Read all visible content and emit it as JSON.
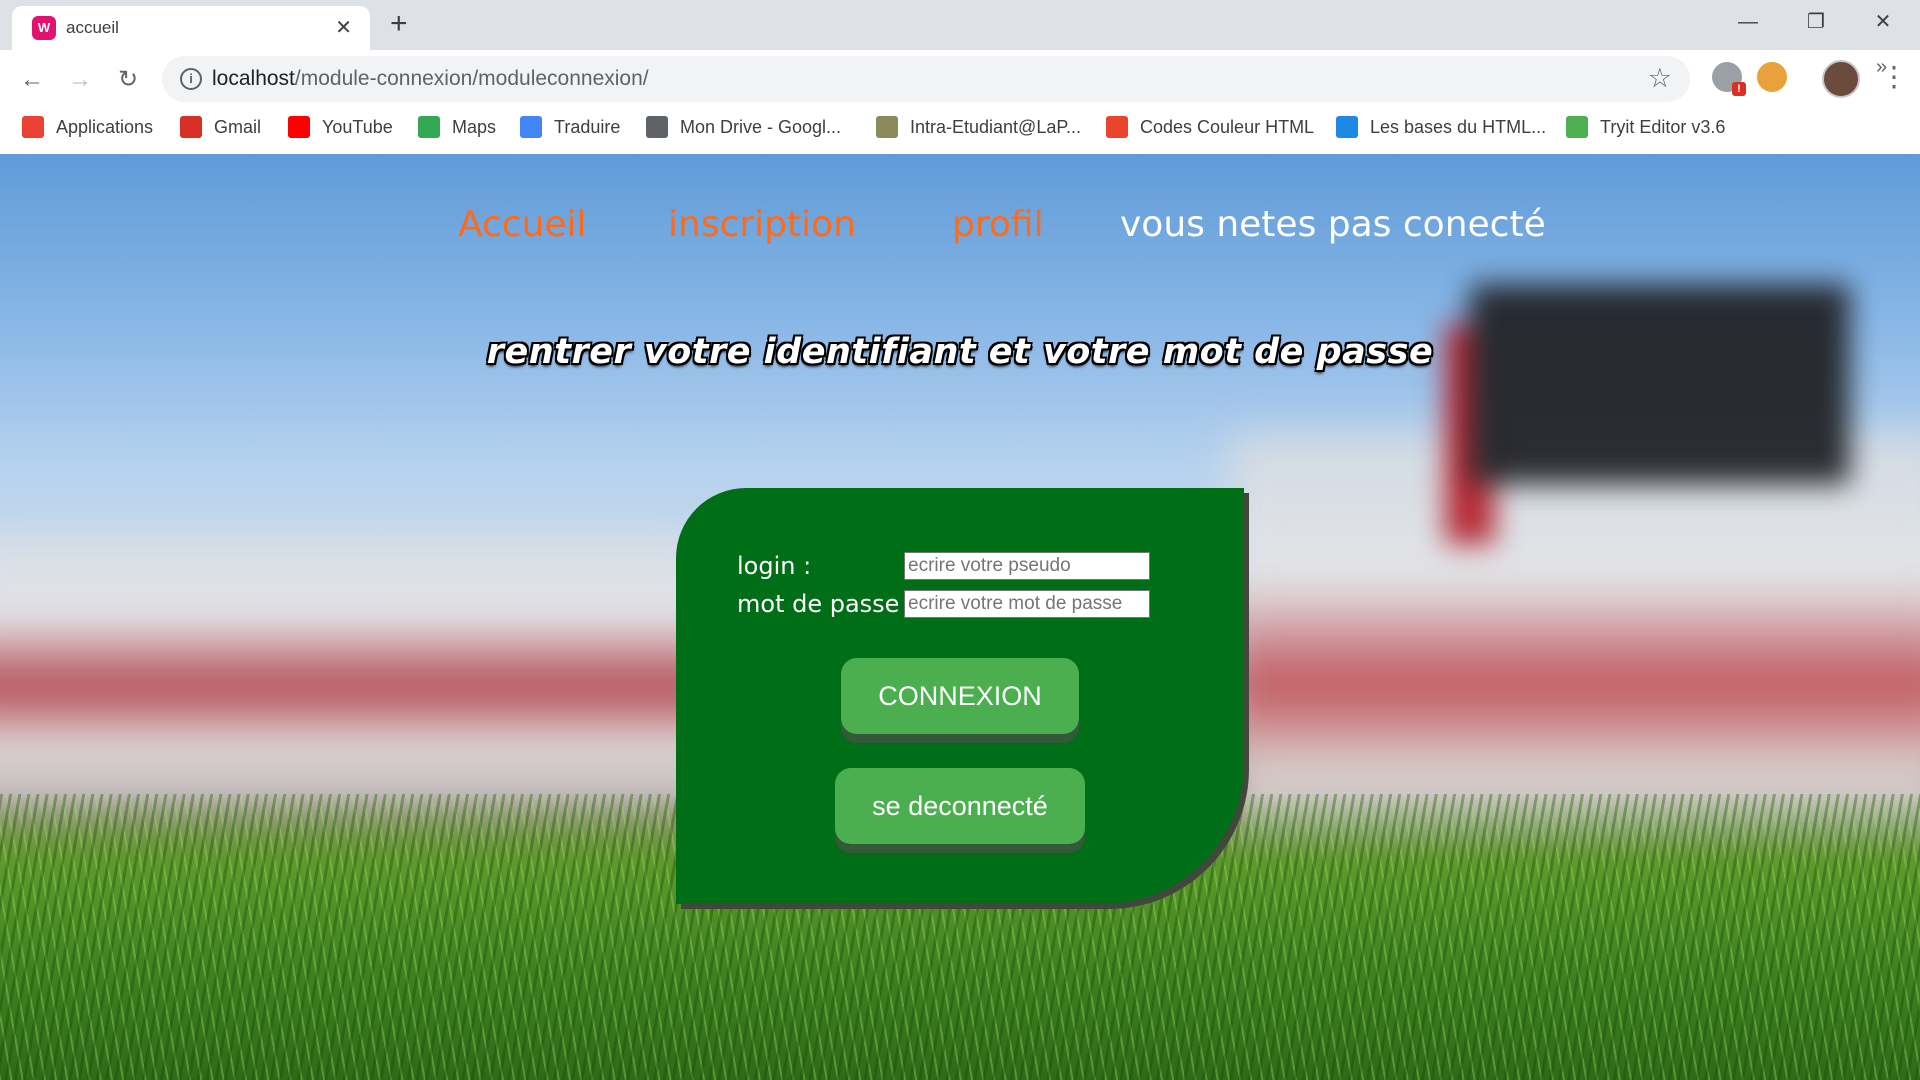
{
  "browser": {
    "tab_title": "accueil",
    "tab_favicon": "W",
    "url_host": "localhost",
    "url_path": "/module-connexion/moduleconnexion/",
    "bookmarks": [
      {
        "label": "Applications",
        "icon": "apps-grid-icon",
        "color": "#ea4335"
      },
      {
        "label": "Gmail",
        "icon": "gmail-icon",
        "color": "#d93025"
      },
      {
        "label": "YouTube",
        "icon": "youtube-icon",
        "color": "#ff0000"
      },
      {
        "label": "Maps",
        "icon": "maps-icon",
        "color": "#34a853"
      },
      {
        "label": "Traduire",
        "icon": "translate-icon",
        "color": "#4285f4"
      },
      {
        "label": "Mon Drive - Googl...",
        "icon": "globe-icon",
        "color": "#5f6368"
      },
      {
        "label": "Intra-Etudiant@LaP...",
        "icon": "intranet-icon",
        "color": "#8a8a5c"
      },
      {
        "label": "Codes Couleur HTML",
        "icon": "color-codes-icon",
        "color": "#e8452c"
      },
      {
        "label": "Les bases du HTML...",
        "icon": "html-basics-icon",
        "color": "#1e88e5"
      },
      {
        "label": "Tryit Editor v3.6",
        "icon": "tryit-icon",
        "color": "#4caf50"
      }
    ]
  },
  "nav": {
    "accueil": "Accueil",
    "inscription": "inscription",
    "profil": "profil",
    "status": "vous netes pas conecté"
  },
  "headline": "rentrer votre identifiant et votre mot de passe",
  "form": {
    "login_label": "login :",
    "login_placeholder": "ecrire votre pseudo",
    "password_label": "mot de passe :",
    "password_placeholder": "ecrire votre mot de passe",
    "connexion_button": "CONNEXION",
    "logout_button": "se deconnecté"
  },
  "colors": {
    "nav_link": "#ff6a1a",
    "card": "#006d17",
    "button": "#4caf4f"
  }
}
